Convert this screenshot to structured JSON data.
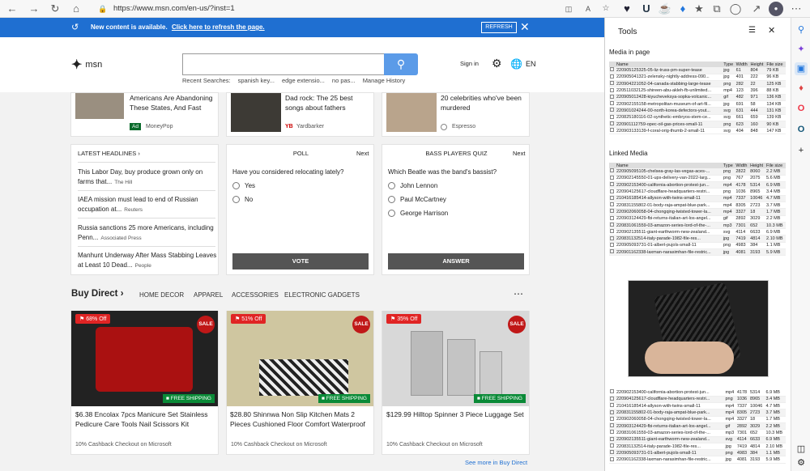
{
  "browser": {
    "url": "https://www.msn.com/en-us/?inst=1"
  },
  "refresh_bar": {
    "message": "New content is available.",
    "link": "Click here to refresh the page.",
    "button": "REFRESH"
  },
  "header": {
    "logo": "msn",
    "recent_label": "Recent Searches:",
    "recent": [
      "spanish key...",
      "edge extensio...",
      "no pas..."
    ],
    "manage": "Manage History",
    "signin": "Sign in",
    "lang": "EN"
  },
  "top_cards": [
    {
      "title": "Americans Are Abandoning These States, And Fast",
      "badge": "Ad",
      "source": "MoneyPop"
    },
    {
      "title": "Dad rock: The 25 best songs about fathers",
      "source": "Yardbarker"
    },
    {
      "title": "20 celebrities who've been murdered",
      "source": "Espresso"
    }
  ],
  "headlines": {
    "title": "LATEST HEADLINES",
    "items": [
      {
        "text": "This Labor Day, buy produce grown only on farms that...",
        "source": "The Hill"
      },
      {
        "text": "IAEA mission must lead to end of Russian occupation at...",
        "source": "Reuters"
      },
      {
        "text": "Russia sanctions 25 more Americans, including Penn...",
        "source": "Associated Press"
      },
      {
        "text": "Manhunt Underway After Mass Stabbing Leaves at Least 10 Dead...",
        "source": "People"
      }
    ]
  },
  "poll": {
    "title": "POLL",
    "next": "Next",
    "question": "Have you considered relocating lately?",
    "options": [
      "Yes",
      "No"
    ],
    "button": "VOTE"
  },
  "quiz": {
    "title": "BASS PLAYERS QUIZ",
    "next": "Next",
    "question": "Which Beatle was the band's bassist?",
    "options": [
      "John Lennon",
      "Paul McCartney",
      "George Harrison"
    ],
    "button": "ANSWER"
  },
  "buy_direct": {
    "title": "Buy Direct",
    "categories": [
      "HOME DECOR",
      "APPAREL",
      "ACCESSORIES",
      "ELECTRONIC GADGETS"
    ],
    "sale_label": "SALE",
    "ship_label": "FREE SHIPPING",
    "products": [
      {
        "discount": "68% Off",
        "title": "$6.38 Encolax 7pcs Manicure Set Stainless Pedicure Care Tools Nail Scissors Kit",
        "cashback": "10% Cashback Checkout on Microsoft"
      },
      {
        "discount": "51% Off",
        "title": "$28.80 Shinnwa Non Slip Kitchen Mats 2 Pieces Cushioned Floor Comfort Waterproof",
        "cashback": "10% Cashback Checkout on Microsoft"
      },
      {
        "discount": "35% Off",
        "title": "$129.99 Hilltop Spinner 3 Piece Luggage Set",
        "cashback": "10% Cashback Checkout on Microsoft"
      }
    ],
    "see_more": "See more in Buy Direct"
  },
  "tools": {
    "title": "Tools",
    "media_label": "Media in page",
    "linked_label": "Linked Media",
    "columns": [
      "Name",
      "Type",
      "Width",
      "Height",
      "File size"
    ],
    "media_rows": [
      [
        "220905125325-05-liz-truss-pm-super-tease",
        "jpg",
        "61",
        "804",
        "79 KB"
      ],
      [
        "220905041321-zelensky-nightly-address-090...",
        "jpg",
        "401",
        "222",
        "96 KB"
      ],
      [
        "220904221052-04-canada-stabbing-large-tease",
        "png",
        "282",
        "22",
        "125 KB"
      ],
      [
        "220511032125-shireen-abu-akleh-fb-unlimited...",
        "mp4",
        "123",
        "396",
        "88 KB"
      ],
      [
        "220905012428-kiyucheveksya-sopka-volcanic...",
        "gif",
        "482",
        "971",
        "136 KB"
      ],
      [
        "220902155158-metropolitan-museum-of-art-fil...",
        "jpg",
        "691",
        "58",
        "134 KB"
      ],
      [
        "220901024244-00-north-korea-defectors-yout...",
        "svg",
        "631",
        "444",
        "131 KB"
      ],
      [
        "220825180116-02-synthetic-embryos-stem-ce...",
        "svg",
        "661",
        "659",
        "139 KB"
      ],
      [
        "220901112759-opec-oil-gas-prices-small-11",
        "png",
        "623",
        "160",
        "90 KB"
      ],
      [
        "220903133139-f-coral-orig-thumb-2-small-11",
        "svg",
        "404",
        "848",
        "147 KB"
      ]
    ],
    "linked_rows": [
      [
        "220905095105-chelsea-gray-las-vegas-aces-...",
        "png",
        "2822",
        "8060",
        "2.2 MB"
      ],
      [
        "220902145550-01-ups-delivery-van-2022-larg...",
        "png",
        "767",
        "2075",
        "5.6 MB"
      ],
      [
        "220902153400-california-abortion-protest-jun...",
        "mp4",
        "4178",
        "5314",
        "6.9 MB"
      ],
      [
        "220904125617-cloudflare-headquarters-restri...",
        "png",
        "1036",
        "8965",
        "3.4 MB"
      ],
      [
        "210416185414-allyson-with-twins-small-11",
        "mp4",
        "7337",
        "10046",
        "4.7 MB"
      ],
      [
        "220831155802-01-body-raja-ampat-blue-park...",
        "mp4",
        "8305",
        "2723",
        "3.7 MB"
      ],
      [
        "220902060058-04-chongqing-twisted-tower-la...",
        "mp4",
        "3327",
        "18",
        "1.7 MB"
      ],
      [
        "220903124429-fbi-returns-italian-art-los-angel...",
        "gif",
        "2892",
        "3029",
        "2.2 MB"
      ],
      [
        "220831061559-03-amazon-series-lord-of-the-...",
        "mp3",
        "7301",
        "652",
        "10.3 MB"
      ],
      [
        "220902135511-giant-earthworm-new-zealand...",
        "svg",
        "4114",
        "6633",
        "6.9 MB"
      ],
      [
        "220831132514-italy-parade-1982-file-res...",
        "jpg",
        "7419",
        "4814",
        "2.10 MB"
      ],
      [
        "220905093731-01-albert-pujols-small-11",
        "png",
        "4983",
        "384",
        "1.1 MB"
      ],
      [
        "220901162338-laxman-narasimhan-file-restric...",
        "jpg",
        "4081",
        "3193",
        "5.9 MB"
      ]
    ],
    "bottom_rows": [
      [
        "220902153400-california-abortion-protest-jun...",
        "mp4",
        "4178",
        "5314",
        "6.9 MB"
      ],
      [
        "220904125617-cloudflare-headquarters-restri...",
        "png",
        "1036",
        "8965",
        "3.4 MB"
      ],
      [
        "210416185414-allyson-with-twins-small-11",
        "mp4",
        "7337",
        "10046",
        "4.7 MB"
      ],
      [
        "220831155802-01-body-raja-ampat-blue-park...",
        "mp4",
        "8305",
        "2723",
        "3.7 MB"
      ],
      [
        "220902060058-04-chongqing-twisted-tower-la...",
        "mp4",
        "3327",
        "18",
        "1.7 MB"
      ],
      [
        "220903124429-fbi-returns-italian-art-los-angel...",
        "gif",
        "2892",
        "3029",
        "2.2 MB"
      ],
      [
        "220831061559-03-amazon-series-lord-of-the-...",
        "mp3",
        "7301",
        "652",
        "10.3 MB"
      ],
      [
        "220902135511-giant-earthworm-new-zealand...",
        "svg",
        "4114",
        "6633",
        "6.9 MB"
      ],
      [
        "220831132514-italy-parade-1982-file-res...",
        "jpg",
        "7419",
        "4814",
        "2.10 MB"
      ],
      [
        "220905093731-01-albert-pujols-small-11",
        "png",
        "4983",
        "384",
        "1.1 MB"
      ],
      [
        "220901162338-laxman-narasimhan-file-restric...",
        "jpg",
        "4081",
        "3193",
        "5.9 MB"
      ]
    ]
  }
}
